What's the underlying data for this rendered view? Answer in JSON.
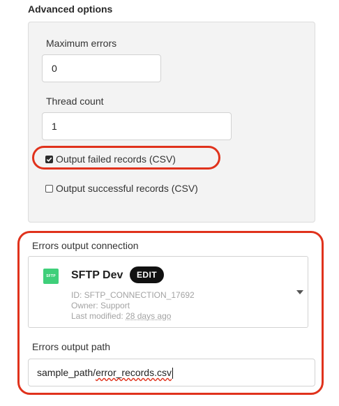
{
  "advanced_options": {
    "title": "Advanced options",
    "max_errors": {
      "label": "Maximum errors",
      "value": "0"
    },
    "thread_count": {
      "label": "Thread count",
      "value": "1"
    },
    "output_failed": {
      "label": "Output failed records (CSV)",
      "checked": true
    },
    "output_successful": {
      "label": "Output successful records (CSV)",
      "checked": false
    }
  },
  "errors_connection": {
    "label": "Errors output connection",
    "logo_text": "SFTP",
    "name": "SFTP Dev",
    "edit_label": "EDIT",
    "id_line": "ID: SFTP_CONNECTION_17692",
    "owner_line": "Owner: Support",
    "modified_prefix": "Last modified:",
    "modified_value": "28 days ago"
  },
  "errors_path": {
    "label": "Errors output path",
    "value_prefix": "sample_path/",
    "value_misspelled": "error_records.csv"
  },
  "colors": {
    "annotation_red": "#e0321c",
    "sftp_green": "#3fcf7a",
    "panel_bg": "#f3f3f3"
  }
}
